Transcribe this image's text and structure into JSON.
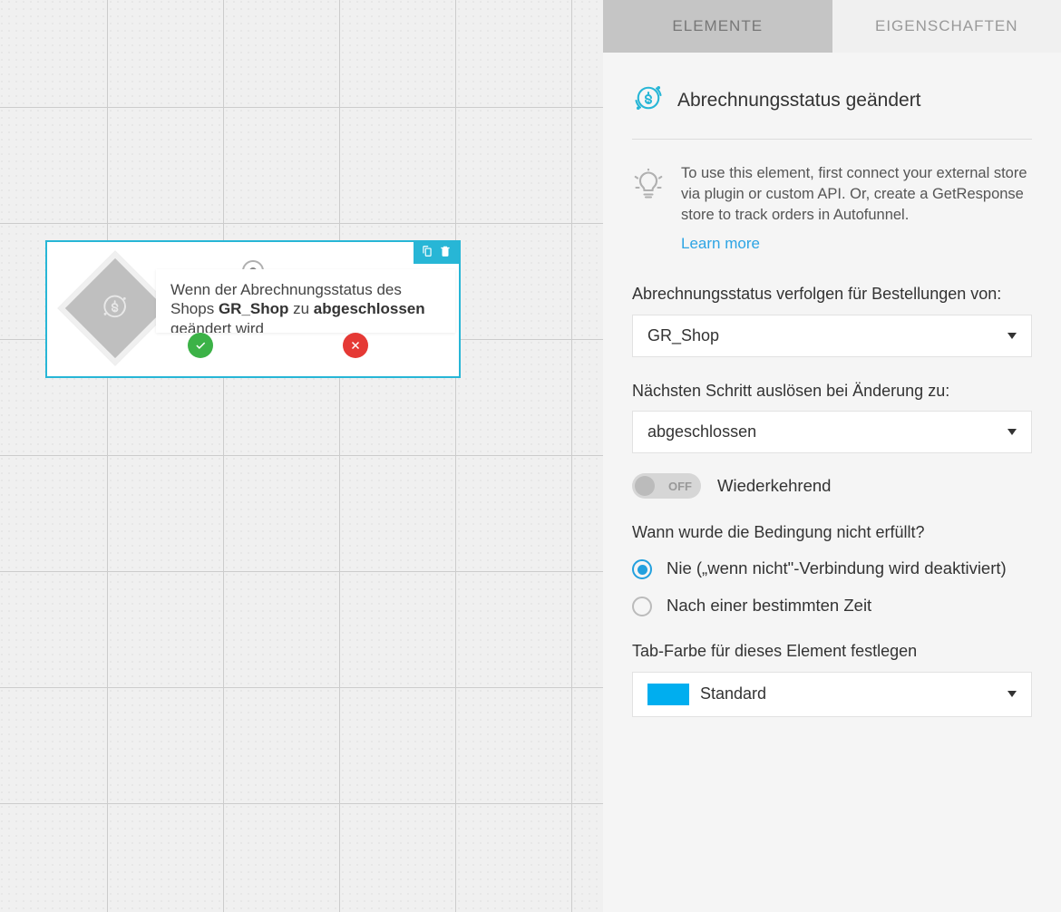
{
  "tabs": {
    "elements": "ELEMENTE",
    "properties": "EIGENSCHAFTEN"
  },
  "header": {
    "title": "Abrechnungsstatus geändert"
  },
  "info": {
    "text": "To use this element, first connect your external store via plugin or custom API. Or, create a GetResponse store to track orders in Autofunnel.",
    "link": "Learn more"
  },
  "node": {
    "text_prefix": "Wenn der Abrechnungsstatus des Shops ",
    "shop": "GR_Shop",
    "text_mid": " zu ",
    "status": "abgeschlossen",
    "text_suffix": " geändert wird"
  },
  "fields": {
    "track_label": "Abrechnungsstatus verfolgen für Bestellungen von:",
    "track_value": "GR_Shop",
    "trigger_label": "Nächsten Schritt auslösen bei Änderung zu:",
    "trigger_value": "abgeschlossen",
    "toggle_state": "OFF",
    "toggle_label": "Wiederkehrend",
    "cond_label": "Wann wurde die Bedingung nicht erfüllt?",
    "radio_never": "Nie („wenn nicht\"-Verbindung wird deaktiviert)",
    "radio_after": "Nach einer bestimmten Zeit",
    "color_label": "Tab-Farbe für dieses Element festlegen",
    "color_value": "Standard"
  }
}
